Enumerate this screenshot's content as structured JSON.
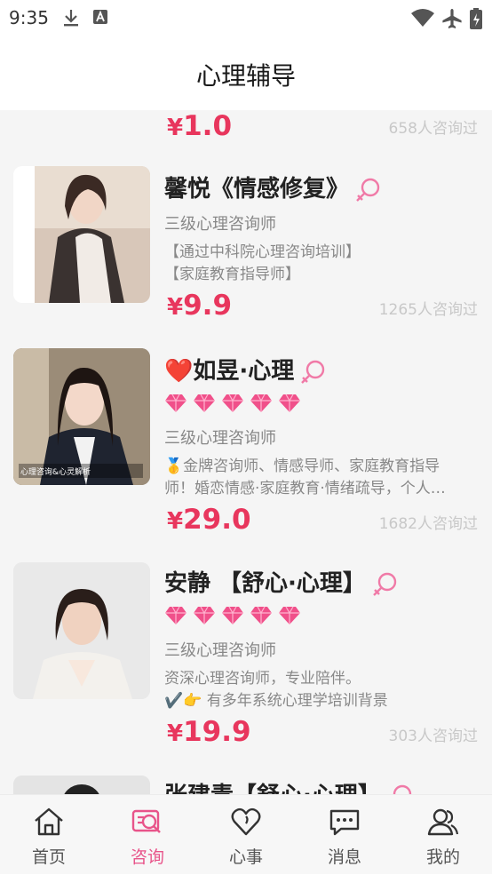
{
  "status_bar": {
    "time": "9:35"
  },
  "header": {
    "title": "心理辅导"
  },
  "partial_top": {
    "price_symbol": "¥",
    "price": "1.0",
    "consult_text": "658人咨询过"
  },
  "counselors": [
    {
      "name": "馨悦《情感修复》",
      "level": "三级心理咨询师",
      "desc_lines": [
        "【通过中科院心理咨询培训】",
        "【家庭教育指导师】"
      ],
      "price_symbol": "¥",
      "price": "9.9",
      "consult_text": "1265人咨询过"
    },
    {
      "name_icon": "❤️",
      "name": "如昱·心理",
      "level": "三级心理咨询师",
      "desc_lines": [
        "🥇金牌咨询师、情感导师、家庭教育指导",
        "师！婚恋情感·家庭教育·情绪疏导，个人…"
      ],
      "photo_caption": "心理咨询&心灵解析",
      "price_symbol": "¥",
      "price": "29.0",
      "consult_text": "1682人咨询过"
    },
    {
      "name": "安静 【舒心·心理】",
      "level": "三级心理咨询师",
      "desc_lines": [
        "资深心理咨询师，专业陪伴。",
        "✔️👉 有多年系统心理学培训背景"
      ],
      "price_symbol": "¥",
      "price": "19.9",
      "consult_text": "303人咨询过"
    },
    {
      "name": "张建青【舒心·心理】"
    }
  ],
  "tabs": [
    {
      "label": "首页",
      "icon": "home-icon",
      "active": false
    },
    {
      "label": "咨询",
      "icon": "consult-icon",
      "active": true
    },
    {
      "label": "心事",
      "icon": "heart-icon",
      "active": false
    },
    {
      "label": "消息",
      "icon": "message-icon",
      "active": false
    },
    {
      "label": "我的",
      "icon": "profile-icon",
      "active": false
    }
  ],
  "colors": {
    "accent": "#e8365d",
    "tab_active": "#e8548a",
    "gem": "#f0508a"
  }
}
